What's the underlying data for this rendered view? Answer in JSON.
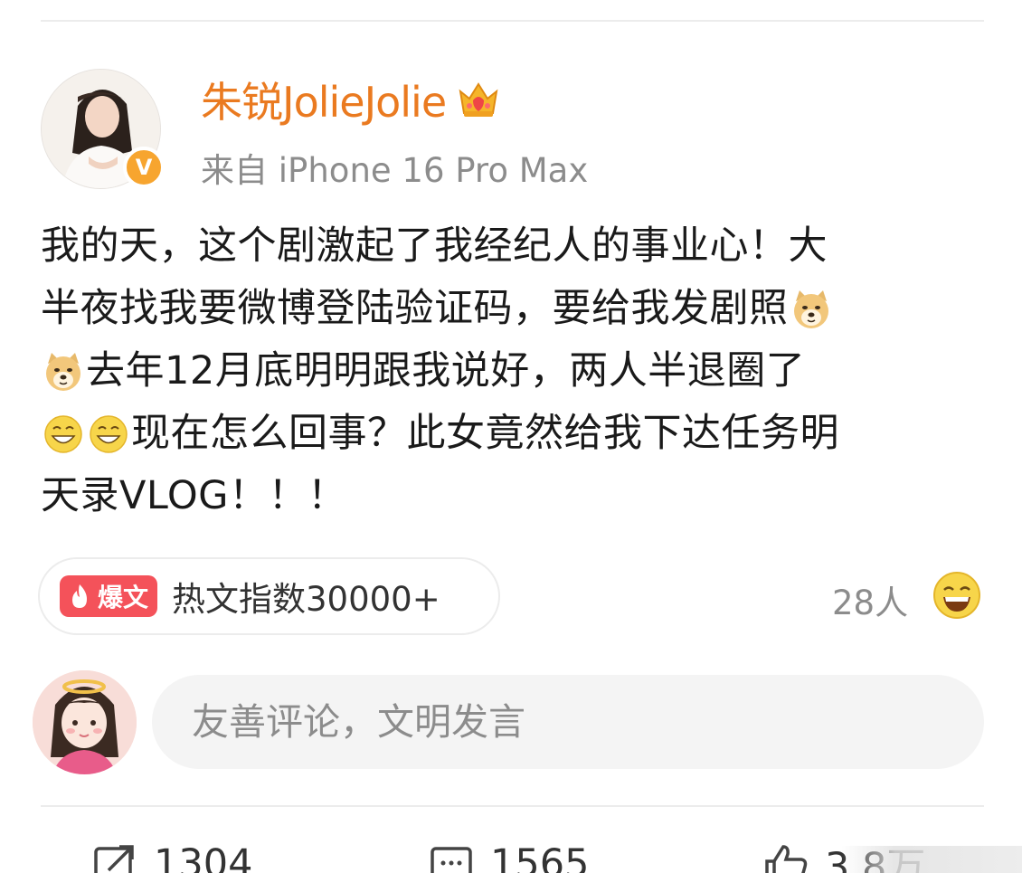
{
  "author": {
    "username": "朱锐JolieJolie",
    "source": "来自 iPhone 16 Pro Max",
    "verified_badge": "V"
  },
  "post": {
    "lines": [
      {
        "text": "我的天，这个剧激起了我经纪人的事业心！大",
        "emoji_after": []
      },
      {
        "text": "半夜找我要微博登陆验证码，要给我发剧照",
        "emoji_after": [
          "doge-emoji"
        ]
      },
      {
        "text": "去年12月底明明跟我说好，两人半退圈了",
        "emoji_before": [
          "doge-emoji"
        ]
      },
      {
        "text": "现在怎么回事？此女竟然给我下达任务明",
        "emoji_before": [
          "grin-emoji",
          "grin-emoji"
        ]
      },
      {
        "text": "天录VLOG！！！"
      }
    ]
  },
  "hot": {
    "badge_label": "爆文",
    "text": "热文指数30000+"
  },
  "likers": {
    "count_text": "28人",
    "emoji": "laugh-emoji"
  },
  "comment_box": {
    "placeholder": "友善评论，文明发言"
  },
  "actions": {
    "repost_count": "1304",
    "comment_count": "1565",
    "like_count": "3.8万"
  },
  "colors": {
    "username": "#ea7a20",
    "verified": "#f7a52f",
    "hot_badge": "#f4525a",
    "muted_text": "#8c8c8c"
  }
}
